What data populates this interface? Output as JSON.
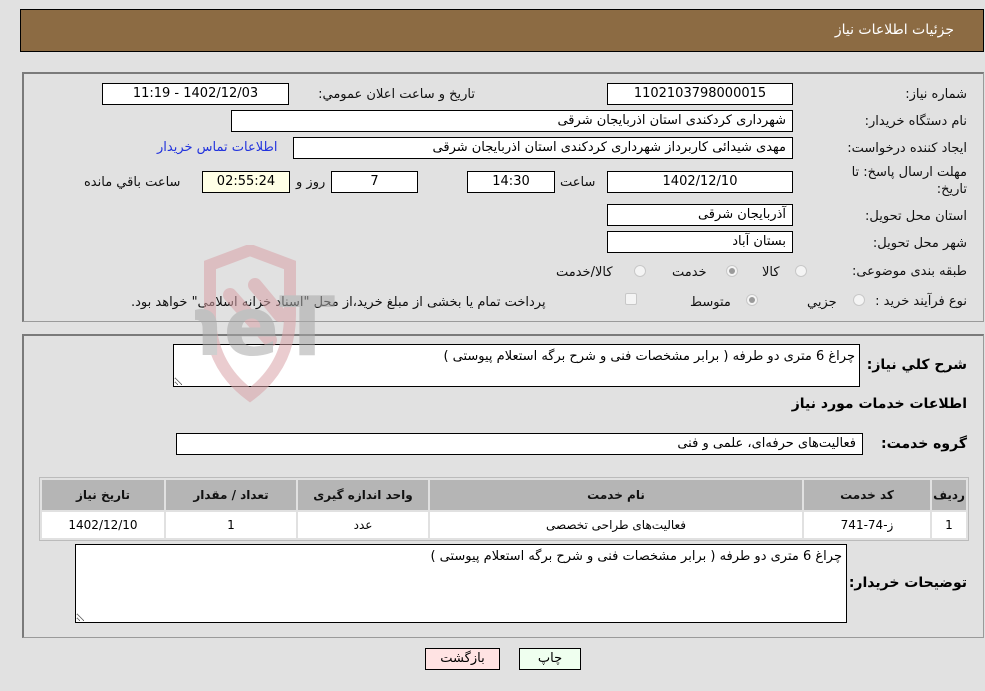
{
  "header": {
    "title": "جزئیات اطلاعات نیاز"
  },
  "details": {
    "need_number_label": "شماره نیاز:",
    "need_number": "1102103798000015",
    "announce_label": "تاریخ و ساعت اعلان عمومي:",
    "announce_value": "1402/12/03 - 11:19",
    "buyer_org_label": "نام دستگاه خریدار:",
    "buyer_org": "شهرداری کردکندی استان اذربایجان شرقی",
    "requester_label": "ایجاد کننده درخواست:",
    "requester": "مهدی شیدائی کاربرداز شهرداری کردکندی استان اذربایجان شرقی",
    "contact_link": "اطلاعات تماس خریدار",
    "deadline_label_line1": "مهلت ارسال پاسخ: تا",
    "deadline_label_line2": "تاریخ:",
    "deadline_date": "1402/12/10",
    "time_label": "ساعت",
    "deadline_time": "14:30",
    "days_value": "7",
    "days_label": "روز و",
    "remaining_time": "02:55:24",
    "remaining_label": "ساعت باقي مانده",
    "province_label": "استان محل تحویل:",
    "province": "آذربایجان شرقی",
    "city_label": "شهر محل تحویل:",
    "city": "بستان آباد",
    "category_label": "طبقه بندی موضوعی:",
    "category_options": [
      {
        "label": "کالا",
        "selected": false
      },
      {
        "label": "خدمت",
        "selected": true
      },
      {
        "label": "کالا/خدمت",
        "selected": false
      }
    ],
    "process_label": "نوع فرآیند خرید :",
    "process_options": [
      {
        "label": "جزيي",
        "selected": false
      },
      {
        "label": "متوسط",
        "selected": true
      }
    ],
    "treasury_checkbox_label": "پرداخت تمام یا بخشی از مبلغ خرید،از محل \"اسناد خزانه اسلامی\" خواهد بود.",
    "treasury_checked": false
  },
  "summary": {
    "label": "شرح کلي نیاز:",
    "value": "چراغ 6 متری دو طرفه ( برابر مشخصات فنی و شرح برگه استعلام پیوستی )"
  },
  "services": {
    "section_title": "اطلاعات خدمات مورد نیاز",
    "group_label": "گروه خدمت:",
    "group_value": "فعالیت‌های حرفه‌ای، علمی و فنی",
    "table": {
      "headers": [
        "ردیف",
        "کد خدمت",
        "نام خدمت",
        "واحد اندازه گیری",
        "تعداد / مقدار",
        "تاریخ نیاز"
      ],
      "rows": [
        [
          "1",
          "ز-74-741",
          "فعالیت‌های طراحی تخصصی",
          "عدد",
          "1",
          "1402/12/10"
        ]
      ]
    }
  },
  "buyer_notes": {
    "label": "توضیحات خریدار:",
    "value": "چراغ 6 متری دو طرفه ( برابر مشخصات فنی و شرح برگه استعلام پیوستی )"
  },
  "buttons": {
    "print": "چاپ",
    "back": "بازگشت"
  },
  "watermark": {
    "text": "AriaTender.neT"
  },
  "colors": {
    "header_bg": "#8c6b43",
    "back_btn_bg": "#ffe3e3",
    "print_btn_bg": "#efffef",
    "link": "#2233dd",
    "table_header_bg": "#b5b5b5"
  }
}
